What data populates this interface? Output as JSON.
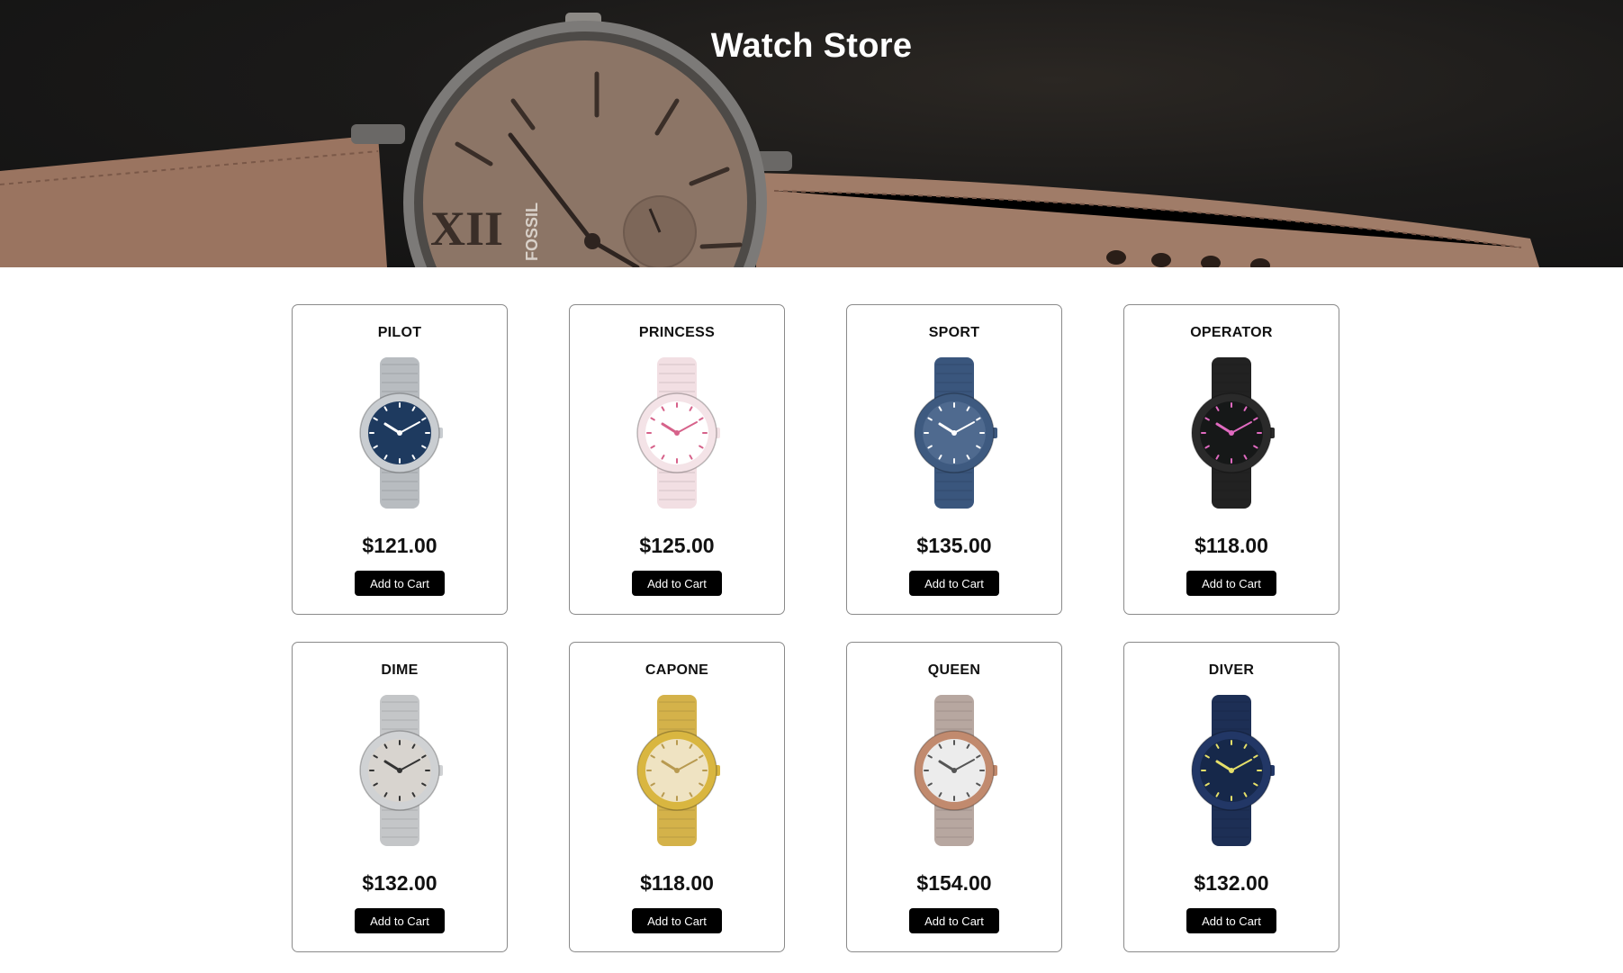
{
  "header": {
    "title": "Watch Store"
  },
  "colors": {
    "button_bg": "#000000",
    "button_text": "#ffffff",
    "card_border": "#8a8a8a"
  },
  "products": [
    {
      "name": "PILOT",
      "price": "$121.00",
      "button": "Add to Cart",
      "dial": "#1e3a5f",
      "strap": "#b8bcc0",
      "case": "#c9cdd1",
      "hands": "#ffffff",
      "icon": "chronograph-watch-icon"
    },
    {
      "name": "PRINCESS",
      "price": "$125.00",
      "button": "Add to Cart",
      "dial": "#ffffff",
      "strap": "#f2dfe3",
      "case": "#f4e3e7",
      "hands": "#d6628a",
      "icon": "pink-watch-icon"
    },
    {
      "name": "SPORT",
      "price": "$135.00",
      "button": "Add to Cart",
      "dial": "#4f6a8f",
      "strap": "#3a567d",
      "case": "#3e5a80",
      "hands": "#ffffff",
      "icon": "blue-watch-icon"
    },
    {
      "name": "OPERATOR",
      "price": "$118.00",
      "button": "Add to Cart",
      "dial": "#161818",
      "strap": "#222222",
      "case": "#2a2a2a",
      "hands": "#e06ac0",
      "icon": "black-watch-icon"
    },
    {
      "name": "DIME",
      "price": "$132.00",
      "button": "Add to Cart",
      "dial": "#d8d4cf",
      "strap": "#c4c6c8",
      "case": "#d0d2d4",
      "hands": "#333333",
      "icon": "silver-watch-icon"
    },
    {
      "name": "CAPONE",
      "price": "$118.00",
      "button": "Add to Cart",
      "dial": "#efe3c2",
      "strap": "#d4b24a",
      "case": "#d9b640",
      "hands": "#b89a50",
      "icon": "gold-watch-icon"
    },
    {
      "name": "QUEEN",
      "price": "$154.00",
      "button": "Add to Cart",
      "dial": "#ececec",
      "strap": "#b7a7a0",
      "case": "#c18a6e",
      "hands": "#555555",
      "icon": "rose-gold-watch-icon"
    },
    {
      "name": "DIVER",
      "price": "$132.00",
      "button": "Add to Cart",
      "dial": "#16284a",
      "strap": "#1d2f55",
      "case": "#223766",
      "hands": "#e6e06a",
      "icon": "navy-watch-icon"
    }
  ]
}
